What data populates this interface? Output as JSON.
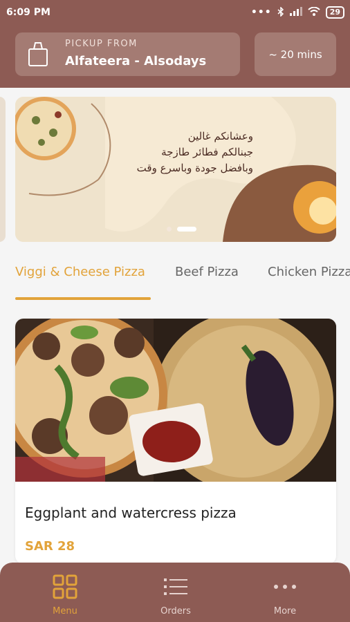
{
  "status_bar": {
    "time": "6:09 PM",
    "battery": "29"
  },
  "header": {
    "pickup_label": "PICKUP FROM",
    "pickup_location": "Alfateera - Alsodays",
    "eta": "~ 20 mins"
  },
  "banner": {
    "lines": [
      "وعشانكم غالين",
      "جبنالكم فطائر طازجة",
      "وبافضل جودة وباسرع وقت"
    ]
  },
  "tabs": [
    {
      "label": "Viggi & Cheese Pizza",
      "active": true
    },
    {
      "label": "Beef Pizza",
      "active": false
    },
    {
      "label": "Chicken Pizza",
      "active": false
    }
  ],
  "product": {
    "name": "Eggplant and watercress pizza",
    "price": "SAR 28"
  },
  "bottom_nav": {
    "items": [
      {
        "label": "Menu",
        "icon": "grid-icon",
        "active": true
      },
      {
        "label": "Orders",
        "icon": "list-icon",
        "active": false
      },
      {
        "label": "More",
        "icon": "more-dots-icon",
        "active": false
      }
    ]
  },
  "colors": {
    "brand": "#8d5b54",
    "accent": "#e2a33a",
    "box": "#a47b73"
  }
}
